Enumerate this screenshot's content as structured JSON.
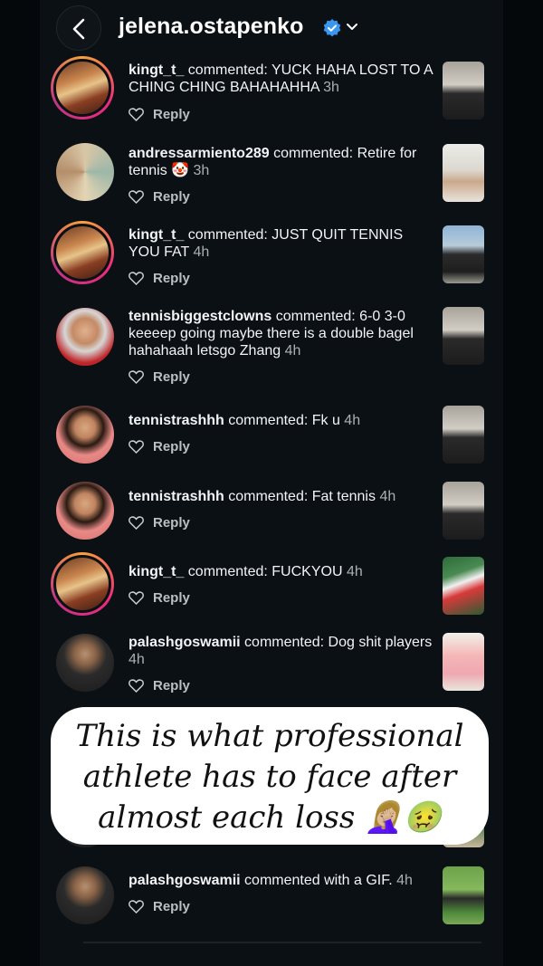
{
  "header": {
    "username": "jelena.ostapenko",
    "verified": true,
    "back_icon": "chevron-left-icon",
    "dropdown_icon": "chevron-down-icon"
  },
  "comments": [
    {
      "user": "kingt_t_",
      "text": " commented: YUCK HAHA LOST TO A CHING CHING BAHAHAHHA",
      "time": "3h",
      "reply": "Reply"
    },
    {
      "user": "andressarmiento289",
      "text": " commented: Retire for tennis 🤡",
      "time": "3h",
      "reply": "Reply"
    },
    {
      "user": "kingt_t_",
      "text": " commented: JUST QUIT TENNIS YOU FAT",
      "time": "4h",
      "reply": "Reply"
    },
    {
      "user": "tennisbiggestclowns",
      "text": " commented: 6-0 3-0 keeeep going maybe there is a double bagel hahahaah letsgo Zhang ",
      "time": "4h",
      "reply": "Reply"
    },
    {
      "user": "tennistrashhh",
      "text": " commented: Fk u",
      "time": "4h",
      "reply": "Reply"
    },
    {
      "user": "tennistrashhh",
      "text": " commented: Fat tennis",
      "time": "4h",
      "reply": "Reply"
    },
    {
      "user": "kingt_t_",
      "text": " commented: FUCKYOU",
      "time": "4h",
      "reply": "Reply"
    },
    {
      "user": "palashgoswamii",
      "text": " commented: Dog shit players",
      "time": "4h",
      "reply": "Reply"
    },
    {
      "user": "palashgoswamii",
      "text": " commented with a GIF.",
      "time": "4h",
      "reply": "Reply"
    }
  ],
  "overlay": {
    "line1": "This is what professional",
    "line2": "athlete has to face after",
    "line3": "almost each loss 🤦🏼‍♀️🤢"
  },
  "colors": {
    "background": "#0b1014",
    "verified_badge": "#3897f0",
    "story_ring": "#ee2a7b"
  }
}
